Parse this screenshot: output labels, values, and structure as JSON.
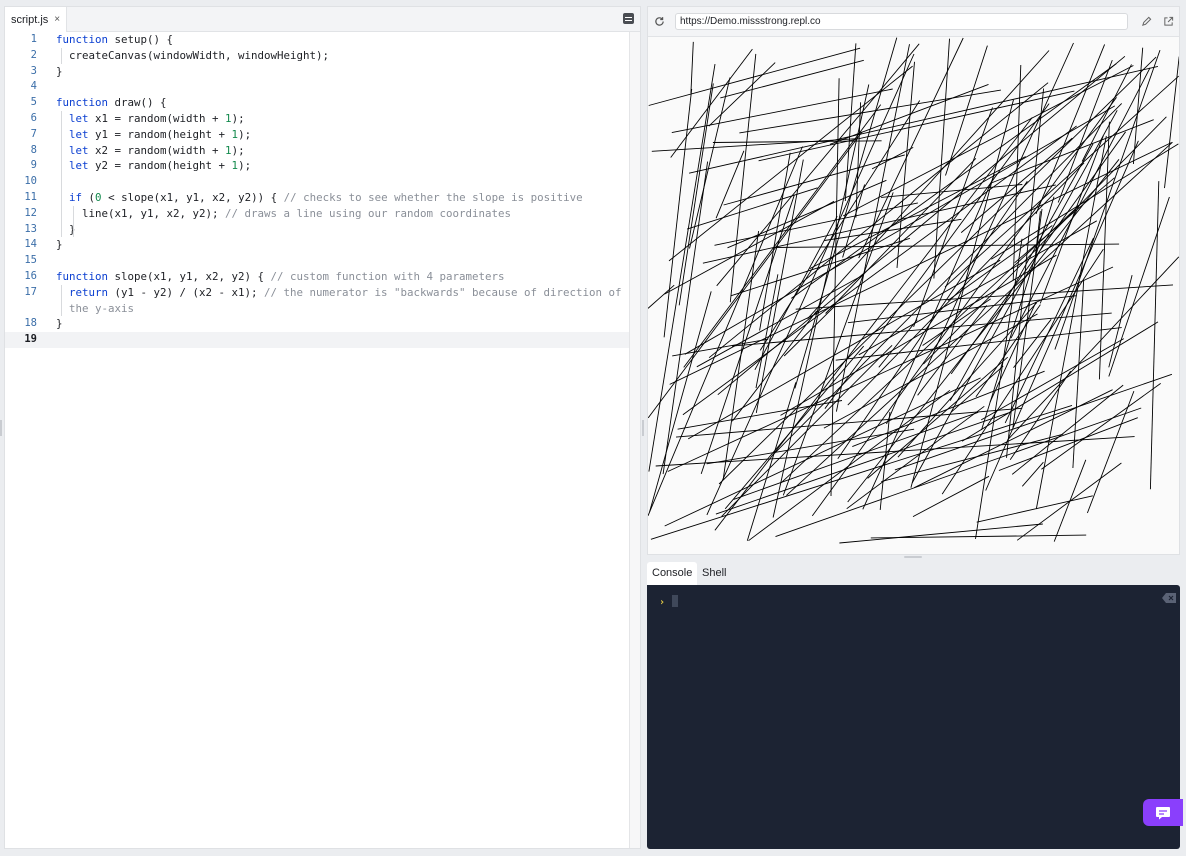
{
  "editor": {
    "tab": {
      "label": "script.js",
      "close": "×"
    },
    "lines": [
      {
        "n": "1",
        "html": "<span class=\"kw\">function</span> setup() {"
      },
      {
        "n": "2",
        "html": "  createCanvas(windowWidth, windowHeight);"
      },
      {
        "n": "3",
        "html": "}"
      },
      {
        "n": "4",
        "html": ""
      },
      {
        "n": "5",
        "html": "<span class=\"kw\">function</span> draw() {"
      },
      {
        "n": "6",
        "html": "  <span class=\"kw\">let</span> x1 = random(width + <span class=\"num\">1</span>);"
      },
      {
        "n": "7",
        "html": "  <span class=\"kw\">let</span> y1 = random(height + <span class=\"num\">1</span>);"
      },
      {
        "n": "8",
        "html": "  <span class=\"kw\">let</span> x2 = random(width + <span class=\"num\">1</span>);"
      },
      {
        "n": "9",
        "html": "  <span class=\"kw\">let</span> y2 = random(height + <span class=\"num\">1</span>);"
      },
      {
        "n": "10",
        "html": ""
      },
      {
        "n": "11",
        "html": "  <span class=\"kw\">if</span> (<span class=\"num\">0</span> &lt; slope(x1, y1, x2, y2)) { <span class=\"cm\">// checks to see whether the slope is positive</span>"
      },
      {
        "n": "12",
        "html": "    line(x1, y1, x2, y2); <span class=\"cm\">// draws a line using our random coordinates</span>"
      },
      {
        "n": "13",
        "html": "  }"
      },
      {
        "n": "14",
        "html": "}"
      },
      {
        "n": "15",
        "html": ""
      },
      {
        "n": "16",
        "html": "<span class=\"kw\">function</span> slope(x1, y1, x2, y2) { <span class=\"cm\">// custom function with 4 parameters</span>"
      },
      {
        "n": "17",
        "html": "  <span class=\"kw\">return</span> (y1 - y2) / (x2 - x1); <span class=\"cm\">// the numerator is \"backwards\" because of direction of\n  the y-axis</span>",
        "wrap": true
      },
      {
        "n": "18",
        "html": "}"
      },
      {
        "n": "19",
        "html": "",
        "active": true
      }
    ]
  },
  "webview": {
    "url": "https://Demo.missstrong.repl.co",
    "line_count": 170,
    "seed": 7
  },
  "console": {
    "tabs": [
      {
        "label": "Console",
        "active": true
      },
      {
        "label": "Shell",
        "active": false
      }
    ],
    "prompt": "›"
  },
  "colors": {
    "accent": "#8a3ffc",
    "console_bg": "#1c2333",
    "keyword": "#0b3fd1",
    "number": "#138a4d",
    "comment": "#8a8f98"
  }
}
